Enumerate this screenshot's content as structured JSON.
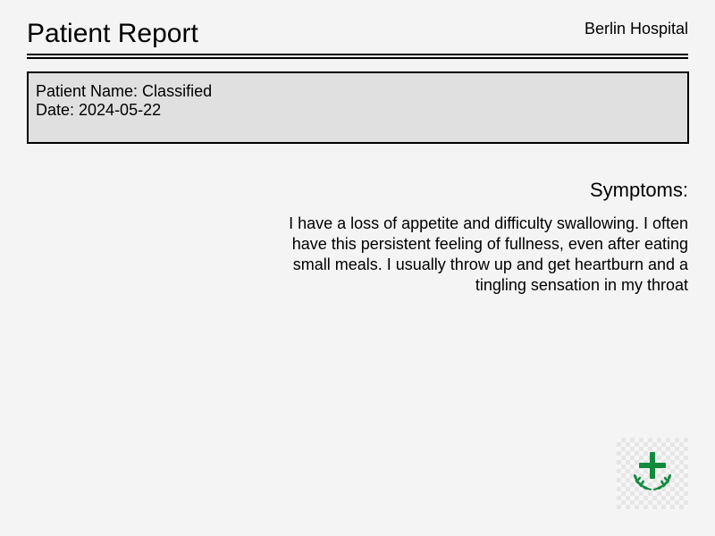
{
  "header": {
    "title": "Patient Report",
    "hospital": "Berlin Hospital"
  },
  "patient": {
    "name_line": "Patient Name: Classified",
    "date_line": "Date: 2024-05-22"
  },
  "symptoms": {
    "heading": "Symptoms:",
    "text": "I have a loss of appetite and difficulty swallowing. I often have this persistent feeling of fullness, even after eating small meals. I usually throw up and get heartburn and a tingling sensation in my throat"
  },
  "logo": {
    "icon": "medical-cross-laurel-icon",
    "color": "#128a3e"
  }
}
